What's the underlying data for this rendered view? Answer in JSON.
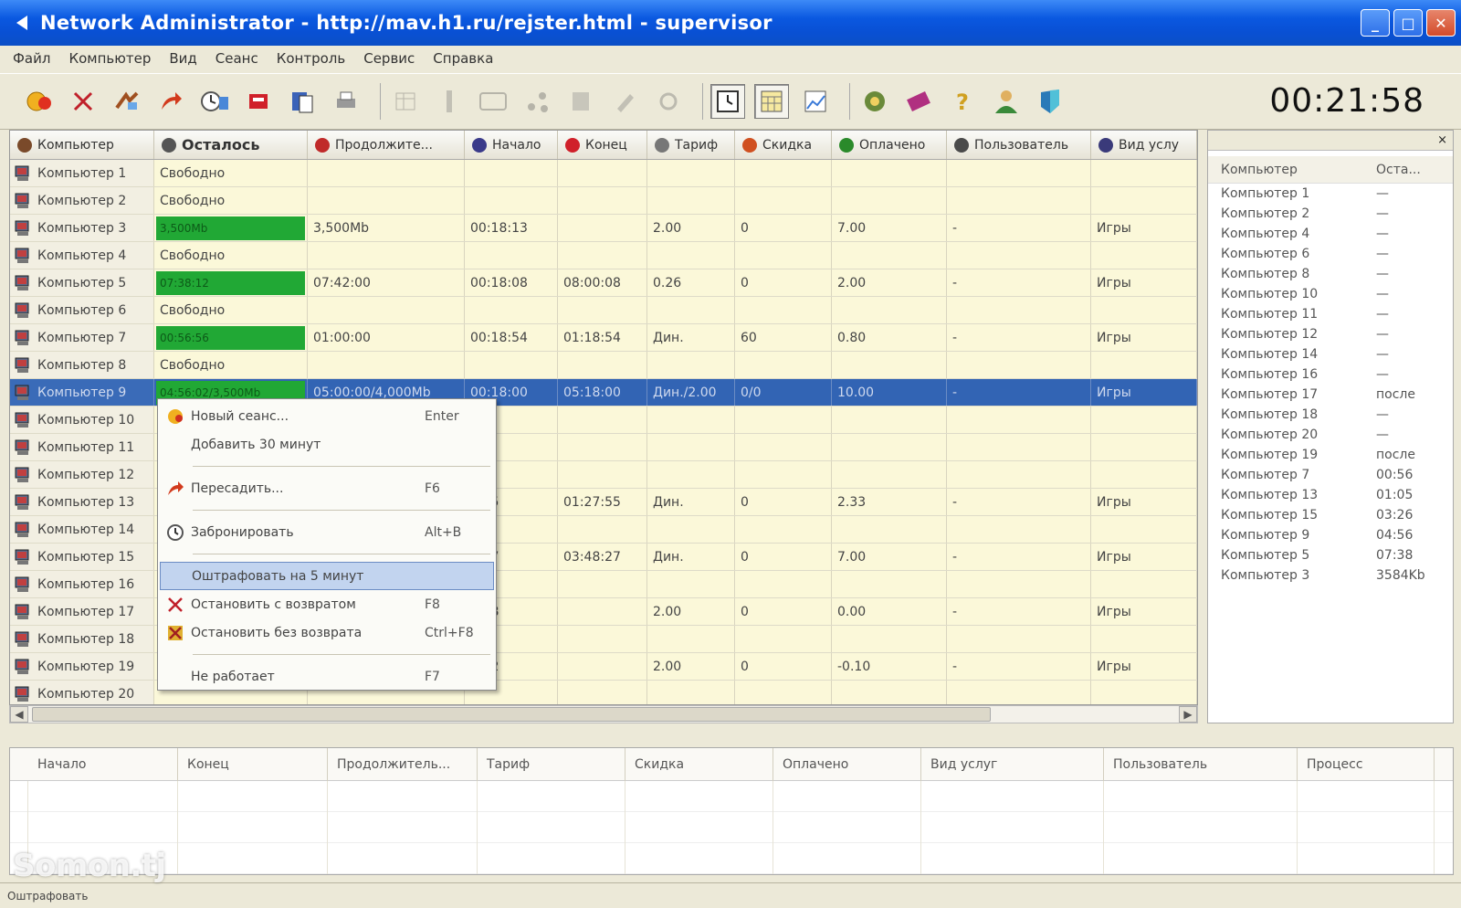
{
  "window": {
    "title": "Network Administrator - http://mav.h1.ru/rejster.html - supervisor",
    "minimize": "_",
    "maximize": "□",
    "close": "✕"
  },
  "menu": [
    "Файл",
    "Компьютер",
    "Вид",
    "Сеанс",
    "Контроль",
    "Сервис",
    "Справка"
  ],
  "clock": "00:21:58",
  "toolbar_icons": [
    "new-session-icon",
    "stop-icon",
    "move-icon",
    "redirect-icon",
    "reserve-icon",
    "shutdown-icon",
    "copy-icon",
    "print-icon",
    "table-icon",
    "info-icon",
    "window-icon",
    "network-icon",
    "list-icon",
    "edit-icon",
    "refresh-icon",
    "clock-view-icon",
    "calendar-view-icon",
    "chart-view-icon",
    "settings-icon",
    "tariff-icon",
    "help-icon",
    "user-icon",
    "shield-icon"
  ],
  "columns": [
    "Компьютер",
    "Осталось",
    "Продолжите...",
    "Начало",
    "Конец",
    "Тариф",
    "Скидка",
    "Оплачено",
    "Пользователь",
    "Вид услу"
  ],
  "rows": [
    {
      "pc": "Компьютер 1",
      "rest": "Свободно",
      "dur": "",
      "start": "",
      "end": "",
      "tariff": "",
      "disc": "",
      "paid": "",
      "user": "",
      "svc": "",
      "busy": false
    },
    {
      "pc": "Компьютер 2",
      "rest": "Свободно",
      "dur": "",
      "start": "",
      "end": "",
      "tariff": "",
      "disc": "",
      "paid": "",
      "user": "",
      "svc": "",
      "busy": false
    },
    {
      "pc": "Компьютер 3",
      "rest": "3,500Mb",
      "dur": "3,500Mb",
      "start": "00:18:13",
      "end": "",
      "tariff": "2.00",
      "disc": "0",
      "paid": "7.00",
      "user": "-",
      "svc": "Игры",
      "busy": true
    },
    {
      "pc": "Компьютер 4",
      "rest": "Свободно",
      "dur": "",
      "start": "",
      "end": "",
      "tariff": "",
      "disc": "",
      "paid": "",
      "user": "",
      "svc": "",
      "busy": false
    },
    {
      "pc": "Компьютер 5",
      "rest": "07:38:12",
      "dur": "07:42:00",
      "start": "00:18:08",
      "end": "08:00:08",
      "tariff": "0.26",
      "disc": "0",
      "paid": "2.00",
      "user": "-",
      "svc": "Игры",
      "busy": true
    },
    {
      "pc": "Компьютер 6",
      "rest": "Свободно",
      "dur": "",
      "start": "",
      "end": "",
      "tariff": "",
      "disc": "",
      "paid": "",
      "user": "",
      "svc": "",
      "busy": false
    },
    {
      "pc": "Компьютер 7",
      "rest": "00:56:56",
      "dur": "01:00:00",
      "start": "00:18:54",
      "end": "01:18:54",
      "tariff": "Дин.",
      "disc": "60",
      "paid": "0.80",
      "user": "-",
      "svc": "Игры",
      "busy": true
    },
    {
      "pc": "Компьютер 8",
      "rest": "Свободно",
      "dur": "",
      "start": "",
      "end": "",
      "tariff": "",
      "disc": "",
      "paid": "",
      "user": "",
      "svc": "",
      "busy": false
    },
    {
      "pc": "Компьютер 9",
      "rest": "04:56:02/3,500Mb",
      "dur": "05:00:00/4,000Mb",
      "start": "00:18:00",
      "end": "05:18:00",
      "tariff": "Дин./2.00",
      "disc": "0/0",
      "paid": "10.00",
      "user": "-",
      "svc": "Игры",
      "busy": true,
      "selected": true
    },
    {
      "pc": "Компьютер 10",
      "rest": "",
      "dur": "",
      "start": "",
      "end": "",
      "tariff": "",
      "disc": "",
      "paid": "",
      "user": "",
      "svc": "",
      "busy": false
    },
    {
      "pc": "Компьютер 11",
      "rest": "",
      "dur": "",
      "start": "",
      "end": "",
      "tariff": "",
      "disc": "",
      "paid": "",
      "user": "",
      "svc": "",
      "busy": false
    },
    {
      "pc": "Компьютер 12",
      "rest": "",
      "dur": "",
      "start": "",
      "end": "",
      "tariff": "",
      "disc": "",
      "paid": "",
      "user": "",
      "svc": "",
      "busy": false
    },
    {
      "pc": "Компьютер 13",
      "rest": "",
      "dur": "",
      "start": "7:55",
      "end": "01:27:55",
      "tariff": "Дин.",
      "disc": "0",
      "paid": "2.33",
      "user": "-",
      "svc": "Игры",
      "busy": false
    },
    {
      "pc": "Компьютер 14",
      "rest": "",
      "dur": "",
      "start": "",
      "end": "",
      "tariff": "",
      "disc": "",
      "paid": "",
      "user": "",
      "svc": "",
      "busy": false
    },
    {
      "pc": "Компьютер 15",
      "rest": "",
      "dur": "",
      "start": "8:27",
      "end": "03:48:27",
      "tariff": "Дин.",
      "disc": "0",
      "paid": "7.00",
      "user": "-",
      "svc": "Игры",
      "busy": false
    },
    {
      "pc": "Компьютер 16",
      "rest": "",
      "dur": "",
      "start": "",
      "end": "",
      "tariff": "",
      "disc": "",
      "paid": "",
      "user": "",
      "svc": "",
      "busy": false
    },
    {
      "pc": "Компьютер 17",
      "rest": "",
      "dur": "",
      "start": "8:18",
      "end": "",
      "tariff": "2.00",
      "disc": "0",
      "paid": "0.00",
      "user": "-",
      "svc": "Игры",
      "busy": false
    },
    {
      "pc": "Компьютер 18",
      "rest": "",
      "dur": "",
      "start": "",
      "end": "",
      "tariff": "",
      "disc": "",
      "paid": "",
      "user": "",
      "svc": "",
      "busy": false
    },
    {
      "pc": "Компьютер 19",
      "rest": "",
      "dur": "",
      "start": "8:02",
      "end": "",
      "tariff": "2.00",
      "disc": "0",
      "paid": "-0.10",
      "user": "-",
      "svc": "Игры",
      "busy": false
    },
    {
      "pc": "Компьютер 20",
      "rest": "",
      "dur": "",
      "start": "",
      "end": "",
      "tariff": "",
      "disc": "",
      "paid": "",
      "user": "",
      "svc": "",
      "busy": false
    }
  ],
  "context_menu": [
    {
      "icon": "new-session-icon",
      "label": "Новый сеанс...",
      "shortcut": "Enter"
    },
    {
      "icon": "",
      "label": "Добавить 30 минут",
      "shortcut": ""
    },
    {
      "sep": true
    },
    {
      "icon": "redirect-icon",
      "label": "Пересадить...",
      "shortcut": "F6"
    },
    {
      "sep": true
    },
    {
      "icon": "reserve-icon",
      "label": "Забронировать",
      "shortcut": "Alt+B"
    },
    {
      "sep": true
    },
    {
      "icon": "",
      "label": "Оштрафовать на 5 минут",
      "shortcut": "",
      "highlighted": true
    },
    {
      "icon": "stop-icon",
      "label": "Остановить с возвратом",
      "shortcut": "F8"
    },
    {
      "icon": "stop-nr-icon",
      "label": "Остановить без возврата",
      "shortcut": "Ctrl+F8"
    },
    {
      "sep": true
    },
    {
      "icon": "",
      "label": "Не работает",
      "shortcut": "F7"
    }
  ],
  "right_panel": {
    "close": "×",
    "col1": "Компьютер",
    "col2": "Оста...",
    "items": [
      [
        "Компьютер 1",
        "—"
      ],
      [
        "Компьютер 2",
        "—"
      ],
      [
        "Компьютер 4",
        "—"
      ],
      [
        "Компьютер 6",
        "—"
      ],
      [
        "Компьютер 8",
        "—"
      ],
      [
        "Компьютер 10",
        "—"
      ],
      [
        "Компьютер 11",
        "—"
      ],
      [
        "Компьютер 12",
        "—"
      ],
      [
        "Компьютер 14",
        "—"
      ],
      [
        "Компьютер 16",
        "—"
      ],
      [
        "Компьютер 17",
        "после"
      ],
      [
        "Компьютер 18",
        "—"
      ],
      [
        "Компьютер 20",
        "—"
      ],
      [
        "Компьютер 19",
        "после"
      ],
      [
        "Компьютер 7",
        "00:56"
      ],
      [
        "Компьютер 13",
        "01:05"
      ],
      [
        "Компьютер 15",
        "03:26"
      ],
      [
        "Компьютер 9",
        "04:56"
      ],
      [
        "Компьютер 5",
        "07:38"
      ],
      [
        "Компьютер 3",
        "3584Kb"
      ]
    ]
  },
  "bottom_columns": [
    "Начало",
    "Конец",
    "Продолжитель...",
    "Тариф",
    "Скидка",
    "Оплачено",
    "Вид услуг",
    "Пользователь",
    "Процесс"
  ],
  "bottom_close": "×",
  "status": "Оштрафовать",
  "watermark": "Somon.tj"
}
